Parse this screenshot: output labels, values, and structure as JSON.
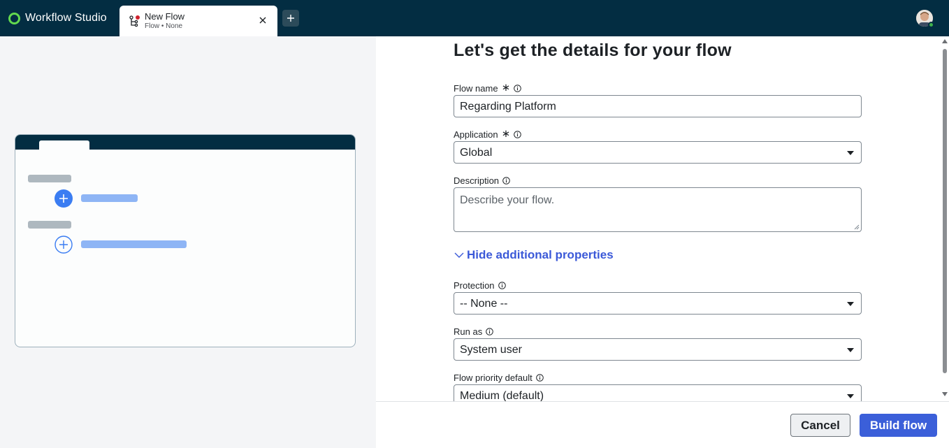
{
  "app": {
    "title": "Workflow Studio",
    "tab": {
      "title": "New Flow",
      "subtitle": "Flow • None"
    }
  },
  "form": {
    "heading": "Let's get the details for your flow",
    "flow_name": {
      "label": "Flow name",
      "required_mark": "∗",
      "value": "Regarding Platform"
    },
    "application": {
      "label": "Application",
      "required_mark": "∗",
      "value": "Global"
    },
    "description": {
      "label": "Description",
      "placeholder": "Describe your flow."
    },
    "toggle_label": "Hide additional properties",
    "protection": {
      "label": "Protection",
      "value": "-- None --"
    },
    "run_as": {
      "label": "Run as",
      "value": "System user"
    },
    "priority": {
      "label": "Flow priority default",
      "value": "Medium (default)"
    }
  },
  "footer": {
    "cancel_label": "Cancel",
    "build_label": "Build flow"
  },
  "colors": {
    "topbar": "#032d42",
    "accent": "#3b5fd9",
    "brand_logo": "#62d84e",
    "tab_dot": "#d0222e"
  },
  "icons": [
    "workflow-logo-icon",
    "flow-icon",
    "close-icon",
    "plus-icon",
    "info-icon",
    "chevron-down-icon",
    "caret-down-icon",
    "user-avatar"
  ]
}
